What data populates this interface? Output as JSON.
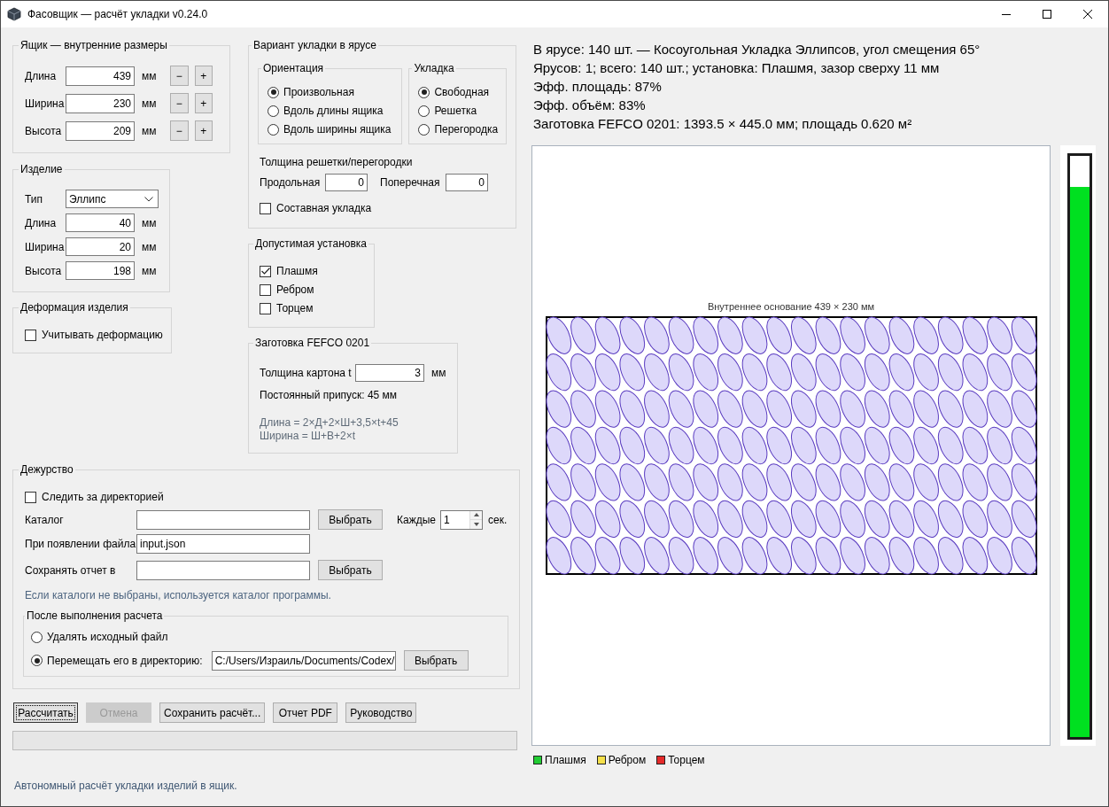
{
  "window": {
    "title": "Фасовщик — расчёт укладки v0.24.0"
  },
  "box": {
    "title": "Ящик — внутренние размеры",
    "fields": [
      {
        "label": "Длина",
        "value": "439",
        "unit": "мм",
        "decrement": "−",
        "increment": "+"
      },
      {
        "label": "Ширина",
        "value": "230",
        "unit": "мм",
        "decrement": "−",
        "increment": "+"
      },
      {
        "label": "Высота",
        "value": "209",
        "unit": "мм",
        "decrement": "−",
        "increment": "+"
      }
    ]
  },
  "product": {
    "title": "Изделие",
    "type": {
      "label": "Тип",
      "value": "Эллипс"
    },
    "fields": [
      {
        "label": "Длина",
        "value": "40",
        "unit": "мм"
      },
      {
        "label": "Ширина",
        "value": "20",
        "unit": "мм"
      },
      {
        "label": "Высота",
        "value": "198",
        "unit": "мм"
      }
    ]
  },
  "deformation": {
    "title": "Деформация изделия",
    "option": {
      "label": "Учитывать деформацию",
      "checked": false
    }
  },
  "layout_variant": {
    "title": "Вариант укладки в ярусе",
    "orientation": {
      "title": "Ориентация",
      "options": [
        {
          "label": "Произвольная",
          "selected": true
        },
        {
          "label": "Вдоль длины ящика",
          "selected": false
        },
        {
          "label": "Вдоль ширины ящика",
          "selected": false
        }
      ]
    },
    "packing": {
      "title": "Укладка",
      "options": [
        {
          "label": "Свободная",
          "selected": true
        },
        {
          "label": "Решетка",
          "selected": false
        },
        {
          "label": "Перегородка",
          "selected": false
        }
      ]
    },
    "divider_thickness": {
      "title": "Толщина решетки/перегородки",
      "fields": [
        {
          "label": "Продольная",
          "value": "0"
        },
        {
          "label": "Поперечная",
          "value": "0"
        }
      ]
    },
    "composite": {
      "label": "Составная укладка",
      "checked": false
    }
  },
  "allowed_placement": {
    "title": "Допустимая установка",
    "options": [
      {
        "label": "Плашмя",
        "checked": true
      },
      {
        "label": "Ребром",
        "checked": false
      },
      {
        "label": "Торцем",
        "checked": false
      }
    ]
  },
  "blank": {
    "title": "Заготовка FEFCO 0201",
    "thickness": {
      "label": "Толщина картона t",
      "value": "3",
      "unit": "мм"
    },
    "allowance": "Постоянный припуск: 45 мм",
    "formulas": [
      "Длина = 2×Д+2×Ш+3,5×t+45",
      "Ширина = Ш+В+2×t"
    ]
  },
  "watch": {
    "title": "Дежурство",
    "watch_option": {
      "label": "Следить за директорией",
      "checked": false
    },
    "catalog": {
      "label": "Каталог",
      "button": "Выбрать"
    },
    "interval": {
      "label": "Каждые",
      "value": "1",
      "unit": "сек."
    },
    "trigger_file": {
      "label": "При появлении файла",
      "value": "input.json"
    },
    "report_dir": {
      "label": "Сохранять отчет в",
      "button": "Выбрать"
    },
    "note": "Если каталоги не выбраны, используется каталог программы.",
    "after_calc": {
      "title": "После выполнения расчета",
      "options": [
        {
          "label": "Удалять исходный файл",
          "selected": false
        },
        {
          "label": "Перемещать его в директорию:",
          "selected": true,
          "path": "C:/Users/Израиль/Documents/Codex/",
          "button": "Выбрать"
        }
      ]
    }
  },
  "actions": [
    {
      "label": "Рассчитать",
      "disabled": false,
      "focused": true
    },
    {
      "label": "Отмена",
      "disabled": true,
      "focused": false
    },
    {
      "label": "Сохранить расчёт...",
      "disabled": false,
      "focused": false
    },
    {
      "label": "Отчет PDF",
      "disabled": false,
      "focused": false
    },
    {
      "label": "Руководство",
      "disabled": false,
      "focused": false
    }
  ],
  "progress": {
    "level": 0
  },
  "status_bar": "Автономный расчёт укладки изделий в ящик.",
  "summary": [
    "В ярусе: 140 шт. — Косоугольная Укладка Эллипсов, угол смещения 65°",
    "Ярусов: 1; всего: 140 шт.; установка: Плашмя, зазор сверху 11 мм",
    "Эфф. площадь: 87%",
    "Эфф. объём: 83%",
    "Заготовка FEFCO 0201: 1393.5 × 445.0 мм; площадь 0.620 м²"
  ],
  "diagram": {
    "caption": "Внутреннее основание 439 × 230 мм"
  },
  "height_meter": {
    "level": 0.947
  },
  "legend": [
    {
      "label": "Плашмя",
      "color": "#22cc33"
    },
    {
      "label": "Ребром",
      "color": "#f5e04a"
    },
    {
      "label": "Торцем",
      "color": "#e52a2a"
    }
  ]
}
